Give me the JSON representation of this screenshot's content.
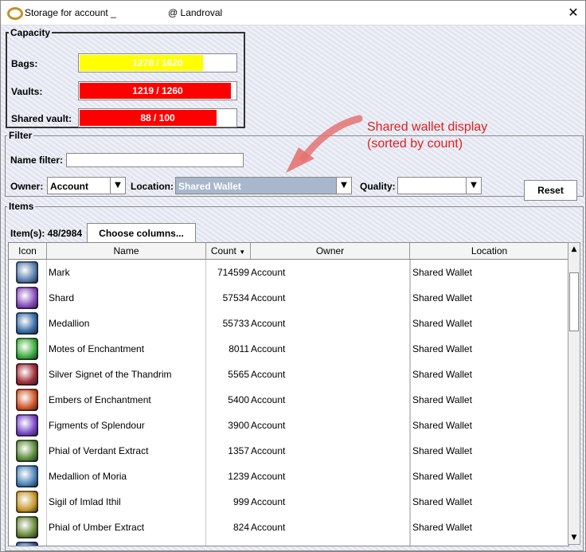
{
  "window": {
    "title": "Storage for account _",
    "title_suffix": "@ Landroval",
    "close_glyph": "✕"
  },
  "capacity": {
    "legend": "Capacity",
    "bags": {
      "label": "Bags:",
      "text": "1278 / 1620",
      "fraction": 0.79,
      "color": "#ffff00"
    },
    "vaults": {
      "label": "Vaults:",
      "text": "1219 / 1260",
      "fraction": 0.97,
      "color": "#ff0000"
    },
    "shared_vault": {
      "label": "Shared vault:",
      "text": "88 / 100",
      "fraction": 0.88,
      "color": "#ff0000"
    }
  },
  "filter": {
    "legend": "Filter",
    "name_filter_label": "Name filter:",
    "name_filter_value": "",
    "owner_label": "Owner:",
    "owner_value": "Account",
    "location_label": "Location:",
    "location_value": "Shared Wallet",
    "quality_label": "Quality:",
    "quality_value": "",
    "reset_label": "Reset"
  },
  "annotation": {
    "line1": "Shared wallet display",
    "line2": "(sorted by count)",
    "color": "#e02020"
  },
  "items": {
    "legend": "Items",
    "count_text": "Item(s): 48/2984",
    "choose_columns_label": "Choose columns...",
    "columns": {
      "icon": "Icon",
      "name": "Name",
      "count": "Count",
      "owner": "Owner",
      "location": "Location"
    },
    "rows": [
      {
        "icon": "mark-icon",
        "color": "#5a7fb0",
        "name": "Mark",
        "count": "714599",
        "owner": "Account",
        "location": "Shared Wallet"
      },
      {
        "icon": "shard-icon",
        "color": "#8a4fc0",
        "name": "Shard",
        "count": "57534",
        "owner": "Account",
        "location": "Shared Wallet"
      },
      {
        "icon": "medallion-icon",
        "color": "#3b6fa8",
        "name": "Medallion",
        "count": "55733",
        "owner": "Account",
        "location": "Shared Wallet"
      },
      {
        "icon": "motes-icon",
        "color": "#3fae3f",
        "name": "Motes of Enchantment",
        "count": "8011",
        "owner": "Account",
        "location": "Shared Wallet"
      },
      {
        "icon": "signet-icon",
        "color": "#a0303a",
        "name": "Silver Signet of the Thandrim",
        "count": "5565",
        "owner": "Account",
        "location": "Shared Wallet"
      },
      {
        "icon": "embers-icon",
        "color": "#d0562a",
        "name": "Embers of Enchantment",
        "count": "5400",
        "owner": "Account",
        "location": "Shared Wallet"
      },
      {
        "icon": "figments-icon",
        "color": "#7a4ac8",
        "name": "Figments of Splendour",
        "count": "3900",
        "owner": "Account",
        "location": "Shared Wallet"
      },
      {
        "icon": "phial-verdant-icon",
        "color": "#5c8c3a",
        "name": "Phial of Verdant Extract",
        "count": "1357",
        "owner": "Account",
        "location": "Shared Wallet"
      },
      {
        "icon": "medallion-moria-icon",
        "color": "#4d86b8",
        "name": "Medallion of Moria",
        "count": "1239",
        "owner": "Account",
        "location": "Shared Wallet"
      },
      {
        "icon": "sigil-icon",
        "color": "#c79a2e",
        "name": "Sigil of Imlad Ithil",
        "count": "999",
        "owner": "Account",
        "location": "Shared Wallet"
      },
      {
        "icon": "phial-umber-icon",
        "color": "#6a8a3a",
        "name": "Phial of Umber Extract",
        "count": "824",
        "owner": "Account",
        "location": "Shared Wallet"
      },
      {
        "icon": "next-item-icon",
        "color": "#3a5fa0",
        "name": "",
        "count": "",
        "owner": "",
        "location": ""
      }
    ]
  }
}
